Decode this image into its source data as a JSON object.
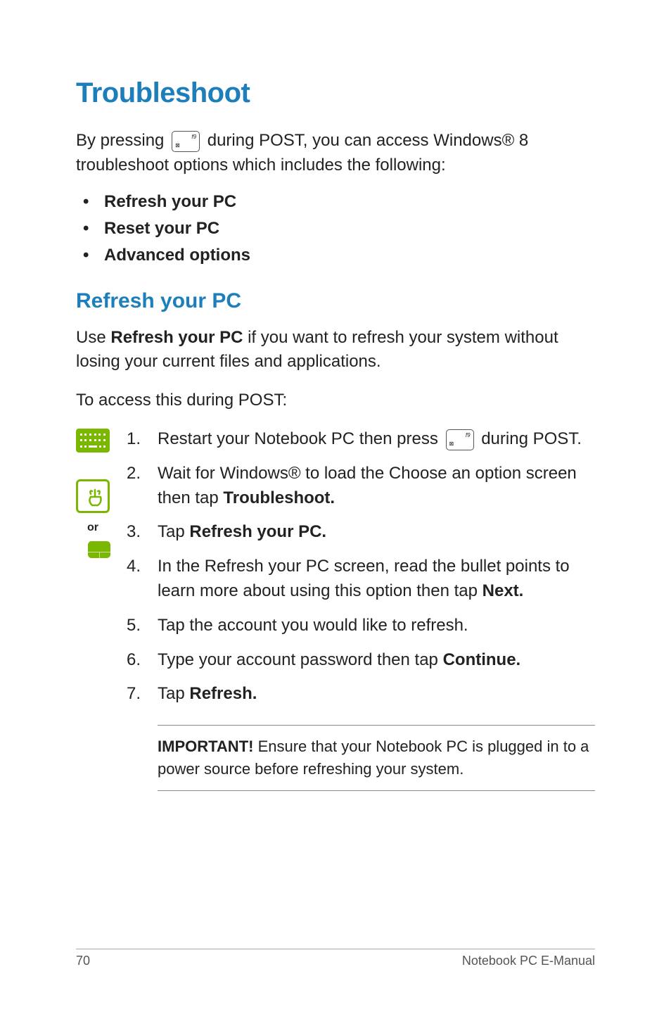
{
  "title": "Troubleshoot",
  "intro_a": "By pressing ",
  "intro_b": " during POST, you can access Windows® 8 troubleshoot options which includes the following:",
  "key_f9_label": "f9",
  "options": [
    "Refresh your PC",
    "Reset your PC",
    "Advanced options"
  ],
  "subhead": "Refresh your PC",
  "refresh_intro_a": "Use ",
  "refresh_intro_b": "Refresh your PC",
  "refresh_intro_c": " if you want to refresh your system without losing your current files and applications.",
  "access_line": "To access this during POST:",
  "or_label": "or",
  "step1_a": "Restart your Notebook PC then press ",
  "step1_b": " during POST.",
  "step2_a": "Wait for Windows® to load the Choose an option screen then tap ",
  "step2_b": "Troubleshoot.",
  "step3_a": "Tap ",
  "step3_b": "Refresh your PC.",
  "step4_a": "In the Refresh your PC screen, read the bullet points to learn more about using this option then tap ",
  "step4_b": "Next.",
  "step5": "Tap the account you would like to refresh.",
  "step6_a": "Type your account password then tap ",
  "step6_b": "Continue.",
  "step7_a": "Tap ",
  "step7_b": "Refresh.",
  "note_a": "IMPORTANT! ",
  "note_b": "Ensure that your Notebook PC is plugged in to a power source before refreshing your system.",
  "footer_page": "70",
  "footer_label": "Notebook PC E-Manual"
}
